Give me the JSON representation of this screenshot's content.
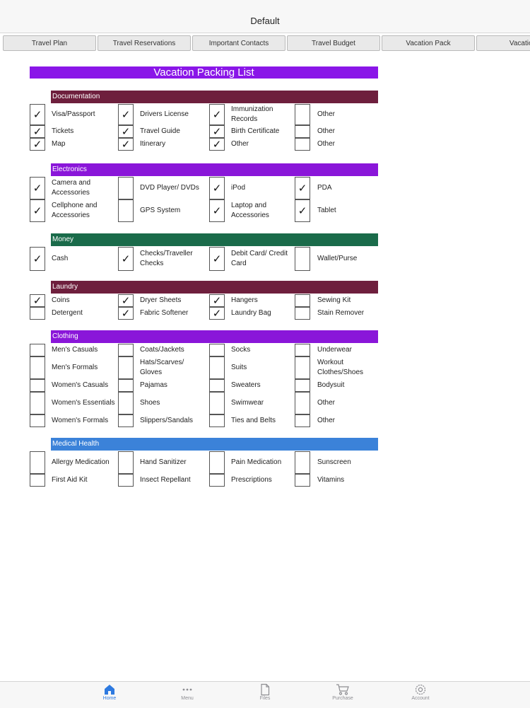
{
  "window": {
    "title": "Default"
  },
  "tabs": [
    "Travel Plan",
    "Travel Reservations",
    "Important Contacts",
    "Travel Budget",
    "Vacation Pack",
    "Vacation"
  ],
  "sheet": {
    "title": "Vacation Packing List"
  },
  "sections": [
    {
      "title": "Documentation",
      "color": "#6e1f3d",
      "rows": [
        [
          {
            "label": "Visa/Passport",
            "checked": true
          },
          {
            "label": "Drivers License",
            "checked": true
          },
          {
            "label": "Immunization Records",
            "checked": true
          },
          {
            "label": "Other",
            "checked": false
          }
        ],
        [
          {
            "label": "Tickets",
            "checked": true
          },
          {
            "label": "Travel Guide",
            "checked": true
          },
          {
            "label": "Birth Certificate",
            "checked": true
          },
          {
            "label": "Other",
            "checked": false
          }
        ],
        [
          {
            "label": "Map",
            "checked": true
          },
          {
            "label": "Itinerary",
            "checked": true
          },
          {
            "label": "Other",
            "checked": true
          },
          {
            "label": "Other",
            "checked": false
          }
        ]
      ]
    },
    {
      "title": "Electronics",
      "color": "#8a16d9",
      "rows": [
        [
          {
            "label": "Camera and Accessories",
            "checked": true
          },
          {
            "label": "DVD Player/ DVDs",
            "checked": false
          },
          {
            "label": "iPod",
            "checked": true
          },
          {
            "label": "PDA",
            "checked": true
          }
        ],
        [
          {
            "label": "Cellphone and Accessories",
            "checked": true
          },
          {
            "label": "GPS System",
            "checked": false
          },
          {
            "label": "Laptop and Accessories",
            "checked": true
          },
          {
            "label": "Tablet",
            "checked": true
          }
        ]
      ]
    },
    {
      "title": "Money",
      "color": "#1a6b4a",
      "rows": [
        [
          {
            "label": "Cash",
            "checked": true
          },
          {
            "label": "Checks/Traveller Checks",
            "checked": true
          },
          {
            "label": "Debit Card/ Credit Card",
            "checked": true
          },
          {
            "label": "Wallet/Purse",
            "checked": false
          }
        ]
      ]
    },
    {
      "title": "Laundry",
      "color": "#6e1f3d",
      "rows": [
        [
          {
            "label": "Coins",
            "checked": true
          },
          {
            "label": "Dryer Sheets",
            "checked": true
          },
          {
            "label": "Hangers",
            "checked": true
          },
          {
            "label": "Sewing Kit",
            "checked": false
          }
        ],
        [
          {
            "label": "Detergent",
            "checked": false
          },
          {
            "label": "Fabric Softener",
            "checked": true
          },
          {
            "label": "Laundry Bag",
            "checked": true
          },
          {
            "label": "Stain Remover",
            "checked": false
          }
        ]
      ]
    },
    {
      "title": "Clothing",
      "color": "#8a16d9",
      "rows": [
        [
          {
            "label": "Men's Casuals",
            "checked": false
          },
          {
            "label": "Coats/Jackets",
            "checked": false
          },
          {
            "label": "Socks",
            "checked": false
          },
          {
            "label": "Underwear",
            "checked": false
          }
        ],
        [
          {
            "label": "Men's Formals",
            "checked": false
          },
          {
            "label": "Hats/Scarves/ Gloves",
            "checked": false
          },
          {
            "label": "Suits",
            "checked": false
          },
          {
            "label": "Workout Clothes/Shoes",
            "checked": false
          }
        ],
        [
          {
            "label": "Women's Casuals",
            "checked": false
          },
          {
            "label": "Pajamas",
            "checked": false
          },
          {
            "label": "Sweaters",
            "checked": false
          },
          {
            "label": "Bodysuit",
            "checked": false
          }
        ],
        [
          {
            "label": "Women's Essentials",
            "checked": false
          },
          {
            "label": "Shoes",
            "checked": false
          },
          {
            "label": "Swimwear",
            "checked": false
          },
          {
            "label": "Other",
            "checked": false
          }
        ],
        [
          {
            "label": "Women's Formals",
            "checked": false
          },
          {
            "label": "Slippers/Sandals",
            "checked": false
          },
          {
            "label": "Ties and Belts",
            "checked": false
          },
          {
            "label": "Other",
            "checked": false
          }
        ]
      ]
    },
    {
      "title": "Medical Health",
      "color": "#3b82d9",
      "rows": [
        [
          {
            "label": "Allergy Medication",
            "checked": false
          },
          {
            "label": "Hand Sanitizer",
            "checked": false
          },
          {
            "label": "Pain Medication",
            "checked": false
          },
          {
            "label": "Sunscreen",
            "checked": false
          }
        ],
        [
          {
            "label": "First Aid Kit",
            "checked": false
          },
          {
            "label": "Insect Repellant",
            "checked": false
          },
          {
            "label": "Prescriptions",
            "checked": false
          },
          {
            "label": "Vitamins",
            "checked": false
          }
        ]
      ]
    }
  ],
  "check_mark": "✓",
  "bottom_nav": [
    {
      "label": "Home",
      "icon": "home-icon",
      "active": true
    },
    {
      "label": "Menu",
      "icon": "more-icon",
      "active": false
    },
    {
      "label": "Files",
      "icon": "file-icon",
      "active": false
    },
    {
      "label": "Purchase",
      "icon": "cart-icon",
      "active": false
    },
    {
      "label": "Account",
      "icon": "gear-icon",
      "active": false
    }
  ],
  "colors": {
    "accent": "#2e7ae0",
    "title_bar": "#8a16e8"
  }
}
